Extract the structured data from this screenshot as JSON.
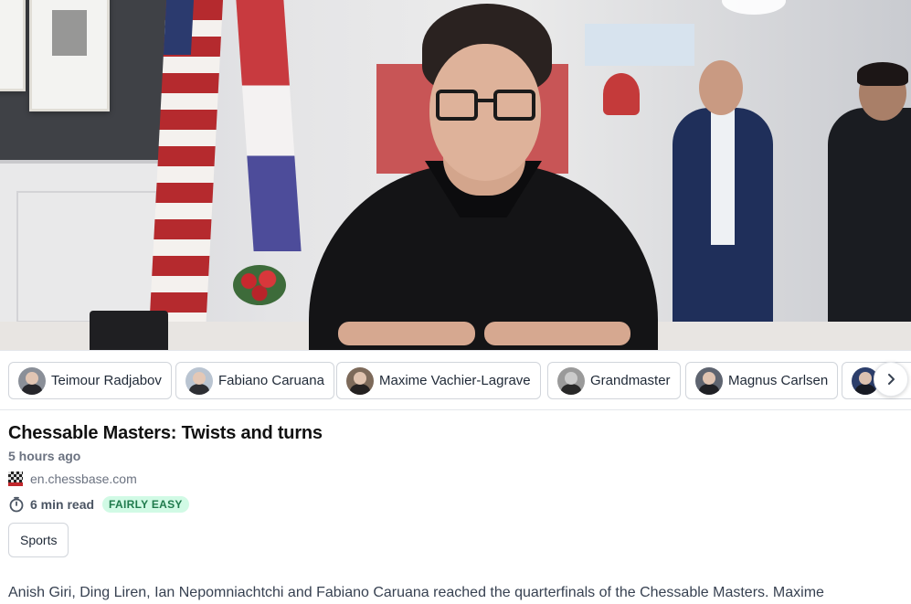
{
  "hero": {
    "image": "photo of chess player seated at table, flags in background"
  },
  "tags": [
    {
      "label": "Teimour Radjabov",
      "icon": "avatar-teimour-radjabov"
    },
    {
      "label": "Fabiano Caruana",
      "icon": "avatar-fabiano-caruana"
    },
    {
      "label": "Maxime Vachier-Lagrave",
      "icon": "avatar-maxime-vachier-lagrave"
    },
    {
      "label": "Grandmaster",
      "icon": "avatar-grandmaster"
    },
    {
      "label": "Magnus Carlsen",
      "icon": "avatar-magnus-carlsen"
    },
    {
      "label": "",
      "icon": "avatar-next-person"
    }
  ],
  "next_icon": "chevron-right-icon",
  "article": {
    "title": "Chessable Masters: Twists and turns",
    "time_ago": "5 hours ago",
    "source": "en.chessbase.com",
    "read_time": "6 min read",
    "difficulty": "FAIRLY EASY",
    "category": "Sports",
    "summary": "Anish Giri, Ding Liren, Ian Nepomniachtchi and Fabiano Caruana reached the quarterfinals of the Chessable Masters. Maxime"
  },
  "colors": {
    "badge_bg": "#d1fae5",
    "badge_text": "#1f7a4c",
    "muted_text": "#6b7280",
    "border": "#d1d5db"
  }
}
